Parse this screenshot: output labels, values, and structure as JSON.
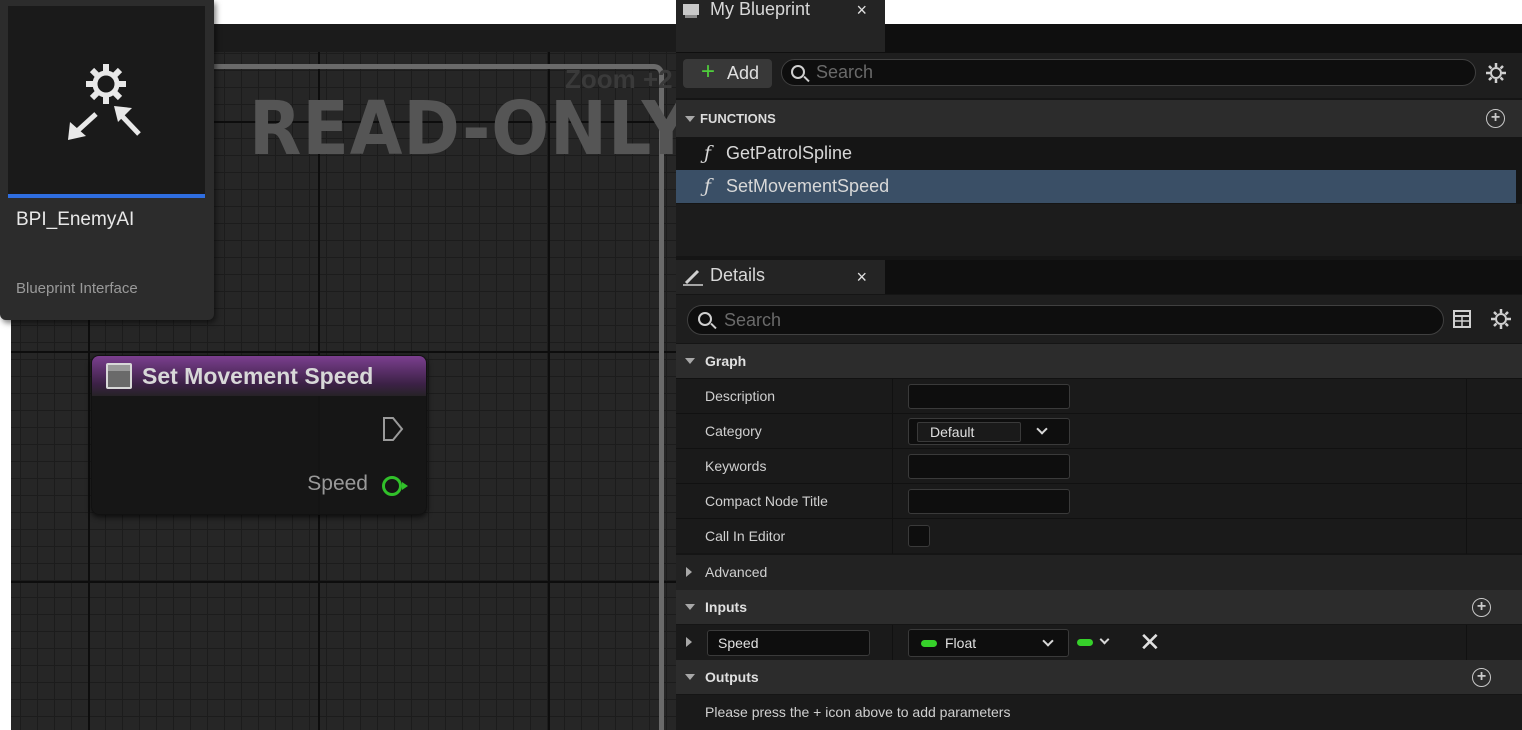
{
  "graph": {
    "zoom_label": "Zoom +2",
    "watermark": "READ-ONLY",
    "node": {
      "title": "Set Movement Speed",
      "output_pin_label": "Speed",
      "pin_color": "#31c02a",
      "header_color": "#7b3f8f"
    }
  },
  "asset_card": {
    "name": "BPI_EnemyAI",
    "type": "Blueprint Interface",
    "icon": "interface-gear-arrows-icon",
    "accent": "#2f6ee0"
  },
  "my_blueprint": {
    "tab_label": "My Blueprint",
    "tab_close": "×",
    "add_label": "Add",
    "add_plus": "+",
    "search_placeholder": "Search",
    "functions_header": "FUNCTIONS",
    "functions": [
      {
        "glyph": "ƒ",
        "label": "GetPatrolSpline",
        "selected": false
      },
      {
        "glyph": "ƒ",
        "label": "SetMovementSpeed",
        "selected": true
      }
    ],
    "selection_color": "#3a4f66"
  },
  "details": {
    "tab_label": "Details",
    "tab_close": "×",
    "search_placeholder": "Search",
    "graph_section": "Graph",
    "rows": {
      "description": "Description",
      "category": "Category",
      "category_value": "Default",
      "keywords": "Keywords",
      "compact_node_title": "Compact Node Title",
      "call_in_editor": "Call In Editor"
    },
    "advanced": "Advanced",
    "inputs_section": "Inputs",
    "input_param": {
      "name": "Speed",
      "type": "Float",
      "remove_glyph": "✕",
      "type_color": "#36d12a"
    },
    "outputs_section": "Outputs",
    "outputs_message": "Please press the + icon above to add parameters"
  }
}
